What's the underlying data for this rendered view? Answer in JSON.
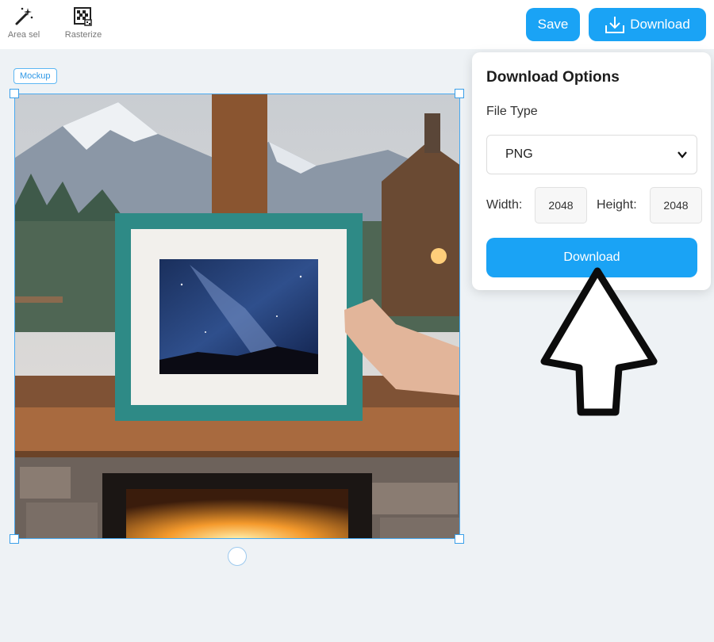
{
  "toolbar": {
    "tools": [
      {
        "label": "Area sel",
        "icon": "magic-wand-icon"
      },
      {
        "label": "Rasterize",
        "icon": "rasterize-icon"
      }
    ],
    "save_label": "Save",
    "download_label": "Download",
    "download_icon": "download-icon"
  },
  "canvas": {
    "layer_tag": "Mockup",
    "selection_color": "#49a9ef"
  },
  "download_panel": {
    "title": "Download Options",
    "file_type_label": "File Type",
    "file_type_value": "PNG",
    "width_label": "Width:",
    "width_value": "2048",
    "height_label": "Height:",
    "height_value": "2048",
    "download_button": "Download"
  },
  "colors": {
    "accent": "#1aa3f5",
    "frame": "#2e8a86",
    "background": "#eef2f5"
  }
}
